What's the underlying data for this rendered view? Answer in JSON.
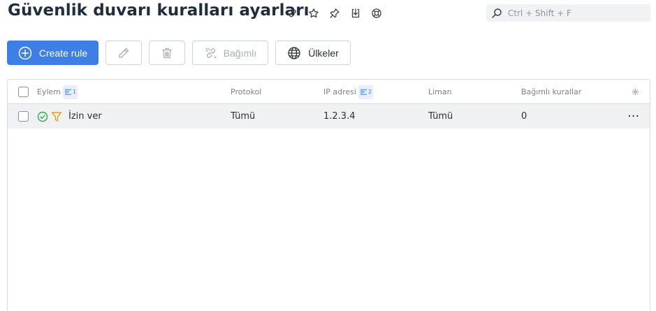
{
  "header": {
    "title": "Güvenlik duvarı kuralları ayarları",
    "icons": [
      "link-icon",
      "star-icon",
      "pin-icon",
      "export-icon",
      "help-icon"
    ]
  },
  "search": {
    "placeholder": "Ctrl + Shift + F",
    "value": ""
  },
  "toolbar": {
    "create_label": "Create rule",
    "edit_icon": "pencil-icon",
    "delete_icon": "trash-icon",
    "dependent_label": "Bağımlı",
    "countries_label": "Ülkeler"
  },
  "table": {
    "columns": {
      "action": "Eylem",
      "action_sort": "1",
      "protocol": "Protokol",
      "ip": "IP adresi",
      "ip_sort": "2",
      "port": "Liman",
      "dependents": "Bağımlı kurallar"
    },
    "rows": [
      {
        "action": "İzin ver",
        "protocol": "Tümü",
        "ip": "1.2.3.4",
        "port": "Tümü",
        "dependents": "0",
        "more": "···"
      }
    ]
  },
  "colors": {
    "accent": "#3d7fe6",
    "success": "#35a852",
    "filter": "#e0a020"
  }
}
